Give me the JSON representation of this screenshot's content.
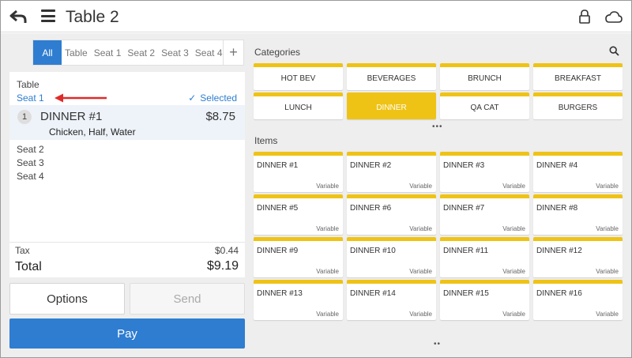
{
  "header": {
    "title": "Table 2"
  },
  "seat_tabs": [
    {
      "label": "All",
      "active": true
    },
    {
      "label": "Table",
      "active": false
    },
    {
      "label": "Seat 1",
      "active": false
    },
    {
      "label": "Seat 2",
      "active": false
    },
    {
      "label": "Seat 3",
      "active": false
    },
    {
      "label": "Seat 4",
      "active": false
    }
  ],
  "seat_add_label": "+",
  "order": {
    "table_label": "Table",
    "current_seat": "Seat 1",
    "selected_label": "Selected",
    "item": {
      "qty": "1",
      "name": "DINNER #1",
      "price": "$8.75",
      "modifiers": "Chicken, Half, Water"
    },
    "other_seats": [
      "Seat 2",
      "Seat 3",
      "Seat 4"
    ]
  },
  "totals": {
    "tax_label": "Tax",
    "tax_value": "$0.44",
    "total_label": "Total",
    "total_value": "$9.19"
  },
  "buttons": {
    "options": "Options",
    "send": "Send",
    "pay": "Pay"
  },
  "categories": {
    "title": "Categories",
    "items": [
      {
        "label": "HOT BEV",
        "active": false
      },
      {
        "label": "BEVERAGES",
        "active": false
      },
      {
        "label": "BRUNCH",
        "active": false
      },
      {
        "label": "BREAKFAST",
        "active": false
      },
      {
        "label": "LUNCH",
        "active": false
      },
      {
        "label": "DINNER",
        "active": true
      },
      {
        "label": "QA CAT",
        "active": false
      },
      {
        "label": "BURGERS",
        "active": false
      }
    ]
  },
  "items": {
    "title": "Items",
    "price_label": "Variable",
    "list": [
      "DINNER #1",
      "DINNER #2",
      "DINNER #3",
      "DINNER #4",
      "DINNER #5",
      "DINNER #6",
      "DINNER #7",
      "DINNER #8",
      "DINNER #9",
      "DINNER #10",
      "DINNER #11",
      "DINNER #12",
      "DINNER #13",
      "DINNER #14",
      "DINNER #15",
      "DINNER #16"
    ]
  },
  "colors": {
    "accent_blue": "#2e7dd1",
    "category_yellow": "#efc316",
    "arrow_red": "#e02b2b"
  },
  "icons": [
    "back-arrow-icon",
    "menu-icon",
    "lock-icon",
    "cloud-icon",
    "search-icon",
    "check-icon"
  ]
}
